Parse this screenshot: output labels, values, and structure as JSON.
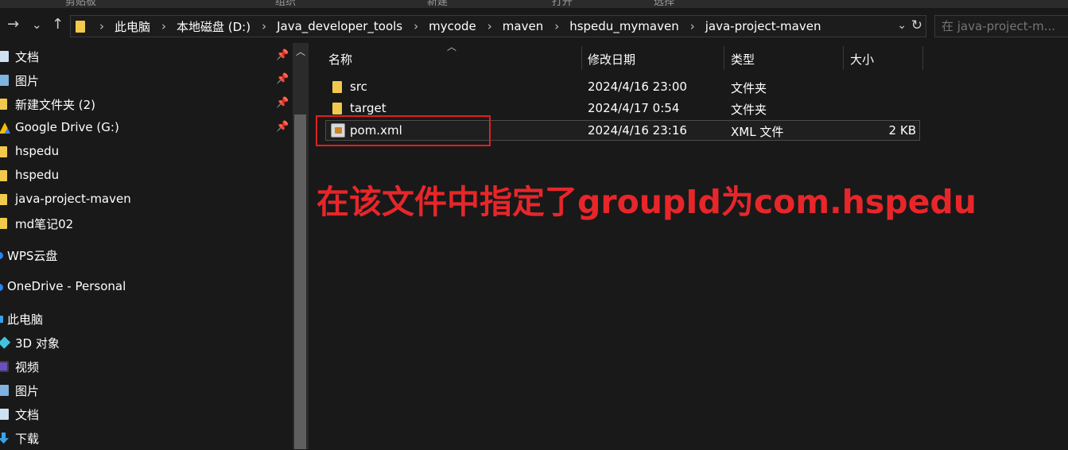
{
  "ribbon": {
    "labels": [
      "剪贴板",
      "组织",
      "新建",
      "打开",
      "选择"
    ]
  },
  "nav": {
    "back": "←",
    "forward": "→",
    "recent": "⌄",
    "up": "↑"
  },
  "address": {
    "crumbs": [
      "此电脑",
      "本地磁盘 (D:)",
      "Java_developer_tools",
      "mycode",
      "maven",
      "hspedu_mymaven",
      "java-project-maven"
    ],
    "separator": "›",
    "dropdown": "⌄",
    "refresh": "↻"
  },
  "search": {
    "placeholder": "在 java-project-m..."
  },
  "sidebar": {
    "items": [
      {
        "label": "文档",
        "icon": "document-icon",
        "pinned": true
      },
      {
        "label": "图片",
        "icon": "pictures-icon",
        "pinned": true
      },
      {
        "label": "新建文件夹 (2)",
        "icon": "folder-icon",
        "pinned": true
      },
      {
        "label": "Google Drive (G:)",
        "icon": "google-drive-icon",
        "pinned": true
      },
      {
        "label": "hspedu",
        "icon": "folder-icon",
        "pinned": false
      },
      {
        "label": "hspedu",
        "icon": "folder-icon",
        "pinned": false
      },
      {
        "label": "java-project-maven",
        "icon": "folder-icon",
        "pinned": false
      },
      {
        "label": "md笔记02",
        "icon": "folder-icon",
        "pinned": false
      },
      {
        "label": "WPS云盘",
        "icon": "cloud-icon",
        "pinned": false
      },
      {
        "label": "OneDrive - Personal",
        "icon": "onedrive-icon",
        "pinned": false
      },
      {
        "label": "此电脑",
        "icon": "computer-icon",
        "pinned": false
      },
      {
        "label": "3D 对象",
        "icon": "3d-objects-icon",
        "pinned": false
      },
      {
        "label": "视频",
        "icon": "video-icon",
        "pinned": false
      },
      {
        "label": "图片",
        "icon": "pictures-icon",
        "pinned": false
      },
      {
        "label": "文档",
        "icon": "document-icon",
        "pinned": false
      },
      {
        "label": "下载",
        "icon": "download-icon",
        "pinned": false
      }
    ],
    "pin_glyph": "📌"
  },
  "columns": {
    "name": "名称",
    "modified": "修改日期",
    "type": "类型",
    "size": "大小"
  },
  "files": [
    {
      "name": "src",
      "modified": "2024/4/16 23:00",
      "type": "文件夹",
      "size": "",
      "icon": "folder-icon"
    },
    {
      "name": "target",
      "modified": "2024/4/17 0:54",
      "type": "文件夹",
      "size": "",
      "icon": "folder-icon"
    },
    {
      "name": "pom.xml",
      "modified": "2024/4/16 23:16",
      "type": "XML 文件",
      "size": "2 KB",
      "icon": "xml-file-icon"
    }
  ],
  "annotation": {
    "text": "在该文件中指定了groupId为com.hspedu",
    "color": "#e8262a"
  },
  "colors": {
    "background": "#191919",
    "folder": "#f2c94c",
    "highlight": "#e02020"
  }
}
